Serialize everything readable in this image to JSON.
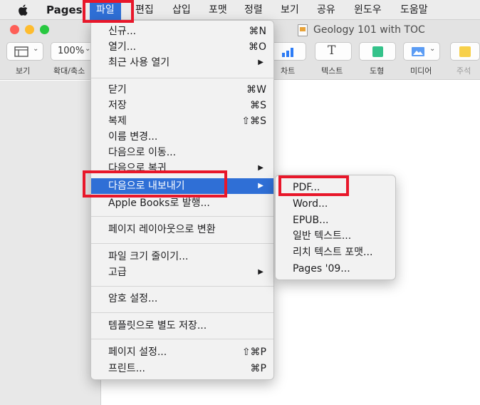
{
  "menubar": {
    "app_name": "Pages",
    "items": [
      "파일",
      "편집",
      "삽입",
      "포맷",
      "정렬",
      "보기",
      "공유",
      "윈도우",
      "도움말"
    ]
  },
  "window": {
    "title": "Geology 101 with TOC"
  },
  "toolbar": {
    "view_label": "보기",
    "zoom_value": "100%",
    "zoom_label": "확대/축소",
    "chart_label": "차트",
    "text_label": "텍스트",
    "shape_label": "도형",
    "media_label": "미디어",
    "comment_label": "주석"
  },
  "file_menu": {
    "new": "신규...",
    "new_sc": "⌘N",
    "open": "열기...",
    "open_sc": "⌘O",
    "recent": "최근 사용 열기",
    "close": "닫기",
    "close_sc": "⌘W",
    "save": "저장",
    "save_sc": "⌘S",
    "duplicate": "복제",
    "duplicate_sc": "⇧⌘S",
    "rename": "이름 변경...",
    "move_to": "다음으로 이동...",
    "revert_to": "다음으로 복귀",
    "export_to": "다음으로 내보내기",
    "publish_books": "Apple Books로 발행...",
    "convert_layout": "페이지 레이아웃으로 변환",
    "reduce_size": "파일 크기 줄이기...",
    "advanced": "고급",
    "set_password": "암호 설정...",
    "save_template": "템플릿으로 별도 저장...",
    "page_setup": "페이지 설정...",
    "page_setup_sc": "⇧⌘P",
    "print": "프린트...",
    "print_sc": "⌘P"
  },
  "export_menu": {
    "items": [
      "PDF...",
      "Word...",
      "EPUB...",
      "일반 텍스트...",
      "리치 텍스트 포맷...",
      "Pages '09..."
    ]
  },
  "colors": {
    "highlight": "#2f6fd6",
    "annotation": "#e8172a",
    "close": "#fe5f57",
    "minimize": "#febc2e",
    "zoom": "#28c840"
  }
}
